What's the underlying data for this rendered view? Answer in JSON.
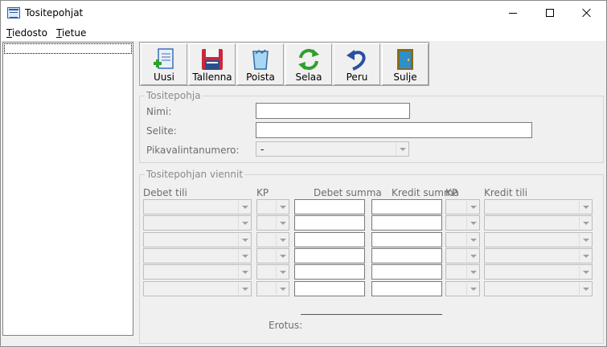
{
  "window": {
    "title": "Tositepohjat"
  },
  "menu": {
    "items": [
      "Tiedosto",
      "Tietue"
    ]
  },
  "toolbar": {
    "buttons": [
      {
        "label": "Uusi",
        "icon": "new-document-icon"
      },
      {
        "label": "Tallenna",
        "icon": "floppy-disk-icon"
      },
      {
        "label": "Poista",
        "icon": "trash-bin-icon"
      },
      {
        "label": "Selaa",
        "icon": "refresh-arrows-icon"
      },
      {
        "label": "Peru",
        "icon": "undo-arrow-icon"
      },
      {
        "label": "Sulje",
        "icon": "door-icon"
      }
    ]
  },
  "template_group": {
    "title": "Tositepohja",
    "name_label": "Nimi:",
    "name_value": "",
    "desc_label": "Selite:",
    "desc_value": "",
    "quick_label": "Pikavalintanumero:",
    "quick_value": "-"
  },
  "entries_group": {
    "title": "Tositepohjan viennit",
    "columns": {
      "debet_tili": "Debet tili",
      "kp1": "KP",
      "debet_summa": "Debet summa",
      "kredit_summa": "Kredit summa",
      "kp2": "KP",
      "kredit_tili": "Kredit tili"
    },
    "row_count": 6,
    "erotus_label": "Erotus:"
  }
}
